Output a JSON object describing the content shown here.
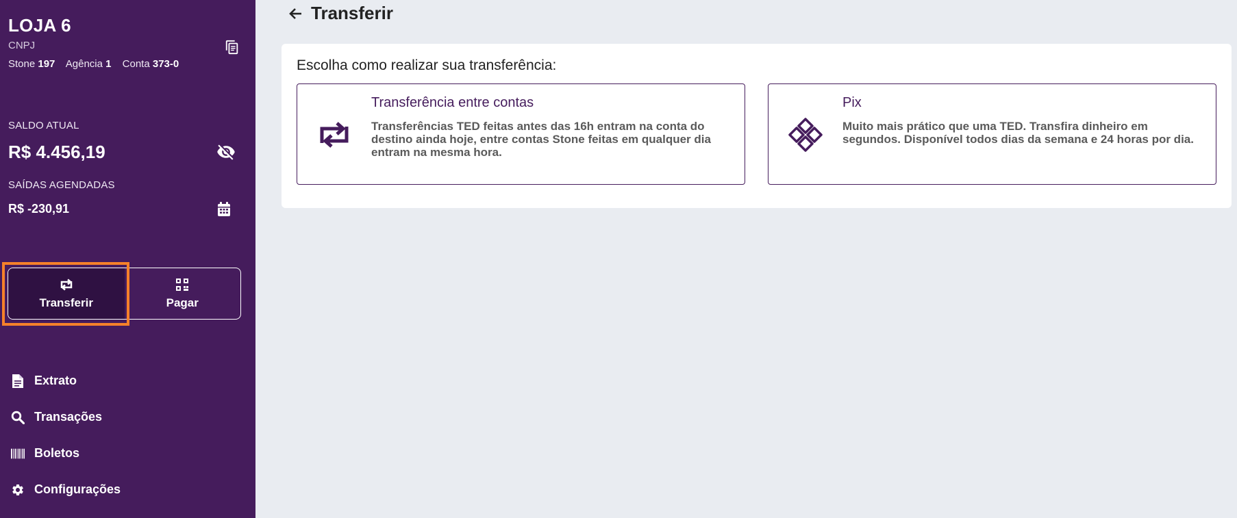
{
  "sidebar": {
    "store_name": "LOJA 6",
    "cnpj_label": "CNPJ",
    "account": {
      "bank_label": "Stone",
      "bank_value": "197",
      "agency_label": "Agência",
      "agency_value": "1",
      "account_label": "Conta",
      "account_value": "373-0"
    },
    "balance": {
      "label": "SALDO ATUAL",
      "value": "R$ 4.456,19"
    },
    "scheduled": {
      "label": "SAÍDAS AGENDADAS",
      "value": "R$ -230,91"
    },
    "actions": [
      {
        "label": "Transferir",
        "icon": "transfer-icon",
        "active": true
      },
      {
        "label": "Pagar",
        "icon": "qr-code-icon",
        "active": false
      }
    ],
    "nav": [
      {
        "label": "Extrato",
        "icon": "document-icon"
      },
      {
        "label": "Transações",
        "icon": "search-icon"
      },
      {
        "label": "Boletos",
        "icon": "barcode-icon"
      },
      {
        "label": "Configurações",
        "icon": "gear-icon"
      }
    ]
  },
  "main": {
    "title": "Transferir",
    "heading": "Escolha como realizar sua transferência:",
    "options": [
      {
        "title": "Transferência entre contas",
        "description": "Transferências TED feitas antes das 16h entram na conta do destino ainda hoje, entre contas Stone feitas em qualquer dia entram na mesma hora.",
        "icon": "transfer-icon"
      },
      {
        "title": "Pix",
        "description": "Muito mais prático que uma TED. Transfira dinheiro em segundos. Disponível todos dias da semana e 24 horas por dia.",
        "icon": "pix-icon"
      }
    ]
  },
  "colors": {
    "sidebar_bg": "#451c5c",
    "active_button_bg": "#2f1142",
    "highlight": "#f5812a",
    "page_bg": "#e9ecf1"
  }
}
